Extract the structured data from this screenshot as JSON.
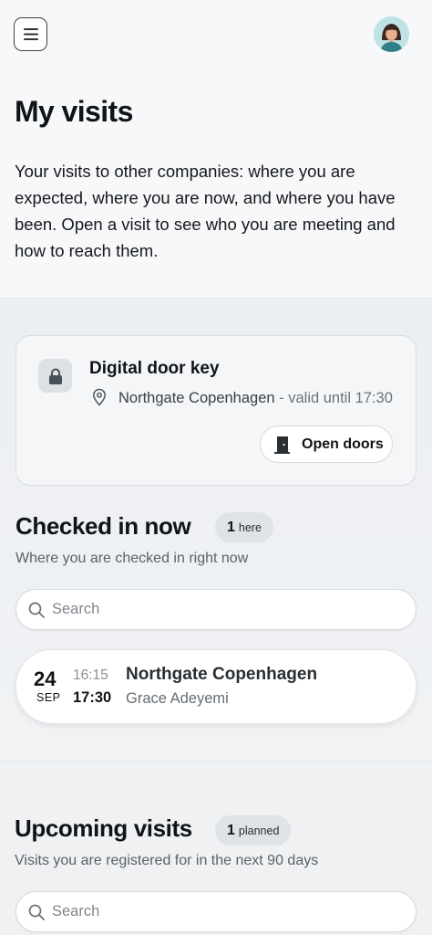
{
  "header": {
    "menu_icon": "hamburger-icon",
    "avatar_icon": "user-avatar"
  },
  "page": {
    "title": "My visits",
    "intro": "Your visits to other companies: where you are expected, where you are now, and where you have been. Open a visit to see who you are meeting and how to reach them."
  },
  "door_key": {
    "icon": "lock-icon",
    "title": "Digital door key",
    "location": "Northgate Copenhagen",
    "validity": " - valid until 17:30",
    "button_label": "Open doors",
    "button_icon": "door-icon"
  },
  "checked_in": {
    "title": "Checked in now",
    "count": "1",
    "count_label": "here",
    "subtitle": "Where you are checked in right now",
    "search_placeholder": "Search",
    "visits": [
      {
        "day": "24",
        "month": "SEP",
        "start": "16:15",
        "end": "17:30",
        "company": "Northgate Copenhagen",
        "host": "Grace Adeyemi"
      }
    ]
  },
  "upcoming": {
    "title": "Upcoming visits",
    "count": "1",
    "count_label": "planned",
    "subtitle": "Visits you are registered for in the next 90 days",
    "search_placeholder": "Search"
  }
}
